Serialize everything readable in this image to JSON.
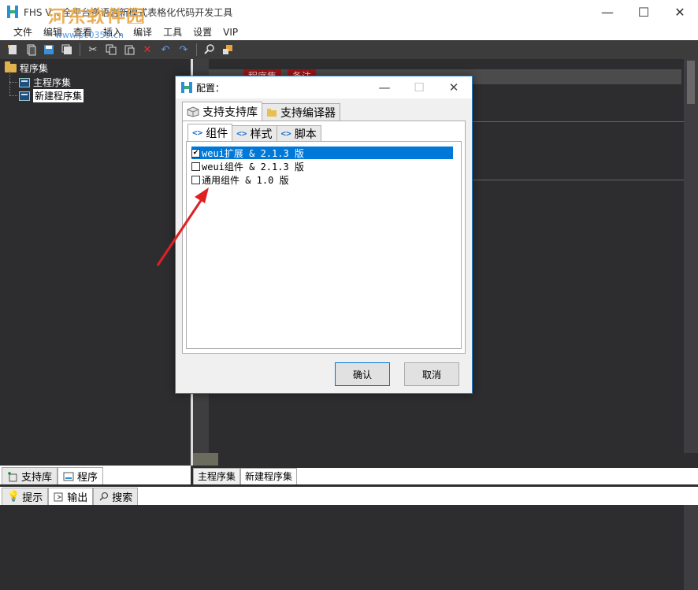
{
  "window": {
    "title": "FHS V... 全平台多语言新模式表格化代码开发工具",
    "watermark": "河东软件园",
    "watermark_url": "www.pc0359.cn",
    "minimize": "—",
    "maximize": "☐",
    "close": "✕"
  },
  "menu": [
    "文件",
    "编辑",
    "查看",
    "插入",
    "编译",
    "工具",
    "设置",
    "VIP"
  ],
  "toolbar": {
    "icons": [
      "new-icon",
      "copy-file-icon",
      "save-icon",
      "save-all-icon",
      "cut-icon",
      "copy-icon",
      "paste-icon",
      "delete-icon",
      "undo-icon",
      "redo-icon",
      "find-icon",
      "replace-icon"
    ]
  },
  "tree": {
    "root": "程序集",
    "items": [
      {
        "label": "主程序集"
      },
      {
        "label": "新建程序集"
      }
    ]
  },
  "editor": {
    "columns": [
      "程序集",
      "备注"
    ]
  },
  "left_tabs": [
    "支持库",
    "程序"
  ],
  "editor_tabs": [
    "主程序集",
    "新建程序集"
  ],
  "bottom_tabs": [
    "提示",
    "输出",
    "搜索"
  ],
  "dialog": {
    "title": "配置：",
    "outer_tabs": [
      "支持支持库",
      "支持编译器"
    ],
    "inner_tabs": [
      "组件",
      "样式",
      "脚本"
    ],
    "items": [
      {
        "label": "weui扩展 & 2.1.3 版",
        "checked": true
      },
      {
        "label": "weui组件 & 2.1.3 版",
        "checked": false
      },
      {
        "label": "通用组件 & 1.0 版",
        "checked": false
      }
    ],
    "ok": "确认",
    "cancel": "取消"
  },
  "colors": {
    "accent": "#0078d7",
    "dark_bg": "#2d2d30",
    "arrow": "#e02020",
    "editor_header": "#9a1616"
  }
}
